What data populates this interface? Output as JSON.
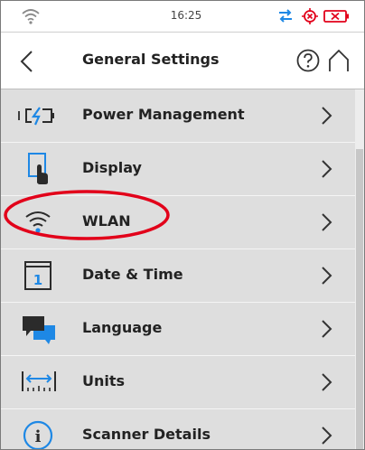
{
  "status_bar": {
    "time": "16:25",
    "icons": [
      "wifi-icon",
      "transfer-arrows-icon",
      "location-target-icon",
      "battery-icon"
    ]
  },
  "header": {
    "title": "General Settings",
    "back_icon": "chevron-left-icon",
    "help_icon": "question-circle-icon",
    "home_icon": "home-icon"
  },
  "settings": {
    "items": [
      {
        "label": "Power Management",
        "icon": "battery-charging-icon"
      },
      {
        "label": "Display",
        "icon": "touch-display-icon"
      },
      {
        "label": "WLAN",
        "icon": "wifi-icon",
        "highlighted": true
      },
      {
        "label": "Date & Time",
        "icon": "calendar-icon",
        "icon_text": "1"
      },
      {
        "label": "Language",
        "icon": "speech-bubbles-icon"
      },
      {
        "label": "Units",
        "icon": "ruler-units-icon"
      },
      {
        "label": "Scanner Details",
        "icon": "info-circle-icon",
        "icon_text": "i"
      }
    ]
  },
  "colors": {
    "accent_blue": "#1e88e5",
    "highlight_red": "#e2001a",
    "list_background": "#dedede",
    "text": "#222222"
  }
}
